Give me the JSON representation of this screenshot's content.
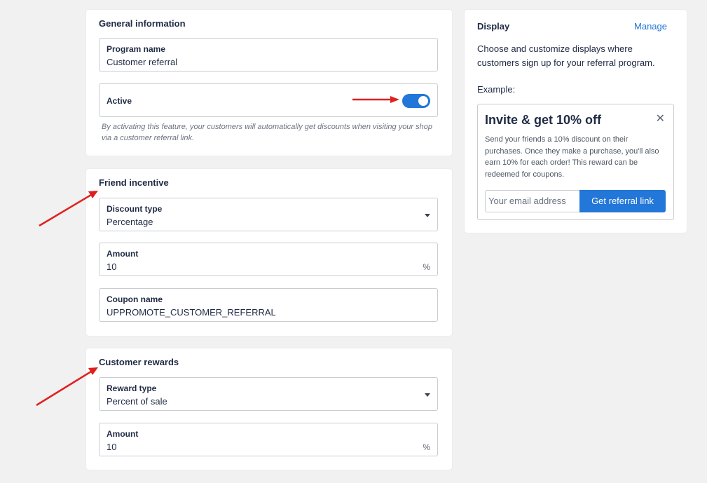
{
  "general": {
    "title": "General information",
    "program_name_label": "Program name",
    "program_name_value": "Customer referral",
    "active_label": "Active",
    "active_on": true,
    "helper": "By activating this feature, your customers will automatically get discounts when visiting your shop via a customer referral link."
  },
  "friend": {
    "title": "Friend incentive",
    "discount_type_label": "Discount type",
    "discount_type_value": "Percentage",
    "amount_label": "Amount",
    "amount_value": "10",
    "amount_suffix": "%",
    "coupon_label": "Coupon name",
    "coupon_value": "UPPROMOTE_CUSTOMER_REFERRAL"
  },
  "customer": {
    "title": "Customer rewards",
    "reward_type_label": "Reward type",
    "reward_type_value": "Percent of sale",
    "amount_label": "Amount",
    "amount_value": "10",
    "amount_suffix": "%"
  },
  "display": {
    "title": "Display",
    "manage": "Manage",
    "description": "Choose and customize displays where customers sign up for your referral program.",
    "example_label": "Example:",
    "preview": {
      "title": "Invite & get 10% off",
      "close": "✕",
      "body": "Send your friends a 10% discount on their purchases. Once they make a purchase, you'll also earn 10% for each order! This reward can be redeemed for coupons.",
      "email_placeholder": "Your email address",
      "button": "Get referral link"
    }
  },
  "colors": {
    "accent": "#2277d8",
    "annotation_arrow": "#e02020",
    "background": "#f1f1f1"
  }
}
